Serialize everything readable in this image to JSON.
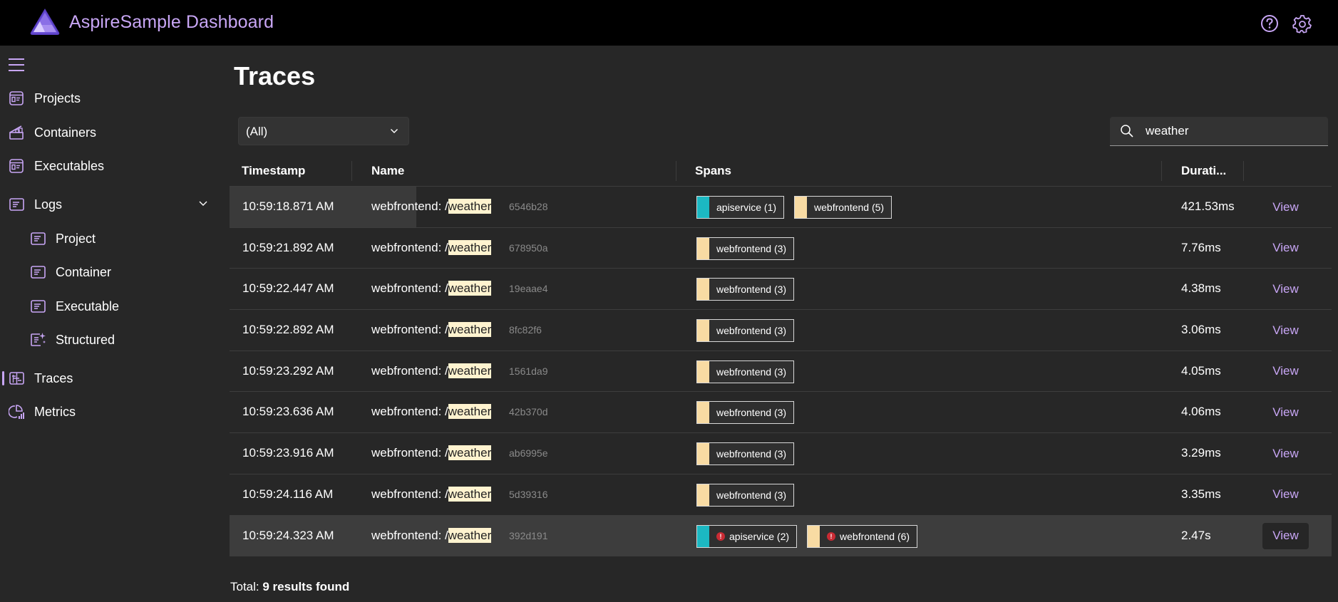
{
  "header": {
    "app_title": "AspireSample Dashboard",
    "help_icon": "help-circle-icon",
    "settings_icon": "gear-icon"
  },
  "sidebar": {
    "menu_icon": "hamburger-icon",
    "items": [
      {
        "label": "Projects",
        "icon": "projects-icon"
      },
      {
        "label": "Containers",
        "icon": "containers-icon"
      },
      {
        "label": "Executables",
        "icon": "executables-icon"
      },
      {
        "label": "Logs",
        "icon": "logs-icon",
        "expanded": true,
        "children": [
          {
            "label": "Project",
            "icon": "log-icon"
          },
          {
            "label": "Container",
            "icon": "log-icon"
          },
          {
            "label": "Executable",
            "icon": "log-icon"
          },
          {
            "label": "Structured",
            "icon": "structured-log-icon"
          }
        ]
      },
      {
        "label": "Traces",
        "icon": "traces-icon",
        "active": true
      },
      {
        "label": "Metrics",
        "icon": "metrics-icon"
      }
    ]
  },
  "main": {
    "title": "Traces",
    "filter": {
      "selected": "(All)"
    },
    "search": {
      "value": "weather",
      "placeholder": ""
    },
    "columns": [
      "Timestamp",
      "Name",
      "Spans",
      "Durati..."
    ],
    "highlight_term": "weather",
    "service_colors": {
      "apiservice": "#1cb8c2",
      "webfrontend": "#f8dba3"
    },
    "rows": [
      {
        "timestamp": "10:59:18.871 AM",
        "name_prefix": "webfrontend: /",
        "name_match": "weather",
        "trace_id": "6546b28",
        "spans": [
          {
            "service": "apiservice",
            "label": "apiservice (1)",
            "error": false
          },
          {
            "service": "webfrontend",
            "label": "webfrontend (5)",
            "error": false
          }
        ],
        "duration": "421.53ms",
        "action": "View"
      },
      {
        "timestamp": "10:59:21.892 AM",
        "name_prefix": "webfrontend: /",
        "name_match": "weather",
        "trace_id": "678950a",
        "spans": [
          {
            "service": "webfrontend",
            "label": "webfrontend (3)",
            "error": false
          }
        ],
        "duration": "7.76ms",
        "action": "View"
      },
      {
        "timestamp": "10:59:22.447 AM",
        "name_prefix": "webfrontend: /",
        "name_match": "weather",
        "trace_id": "19eaae4",
        "spans": [
          {
            "service": "webfrontend",
            "label": "webfrontend (3)",
            "error": false
          }
        ],
        "duration": "4.38ms",
        "action": "View"
      },
      {
        "timestamp": "10:59:22.892 AM",
        "name_prefix": "webfrontend: /",
        "name_match": "weather",
        "trace_id": "8fc82f6",
        "spans": [
          {
            "service": "webfrontend",
            "label": "webfrontend (3)",
            "error": false
          }
        ],
        "duration": "3.06ms",
        "action": "View"
      },
      {
        "timestamp": "10:59:23.292 AM",
        "name_prefix": "webfrontend: /",
        "name_match": "weather",
        "trace_id": "1561da9",
        "spans": [
          {
            "service": "webfrontend",
            "label": "webfrontend (3)",
            "error": false
          }
        ],
        "duration": "4.05ms",
        "action": "View"
      },
      {
        "timestamp": "10:59:23.636 AM",
        "name_prefix": "webfrontend: /",
        "name_match": "weather",
        "trace_id": "42b370d",
        "spans": [
          {
            "service": "webfrontend",
            "label": "webfrontend (3)",
            "error": false
          }
        ],
        "duration": "4.06ms",
        "action": "View"
      },
      {
        "timestamp": "10:59:23.916 AM",
        "name_prefix": "webfrontend: /",
        "name_match": "weather",
        "trace_id": "ab6995e",
        "spans": [
          {
            "service": "webfrontend",
            "label": "webfrontend (3)",
            "error": false
          }
        ],
        "duration": "3.29ms",
        "action": "View"
      },
      {
        "timestamp": "10:59:24.116 AM",
        "name_prefix": "webfrontend: /",
        "name_match": "weather",
        "trace_id": "5d39316",
        "spans": [
          {
            "service": "webfrontend",
            "label": "webfrontend (3)",
            "error": false
          }
        ],
        "duration": "3.35ms",
        "action": "View"
      },
      {
        "timestamp": "10:59:24.323 AM",
        "name_prefix": "webfrontend: /",
        "name_match": "weather",
        "trace_id": "392d191",
        "spans": [
          {
            "service": "apiservice",
            "label": "apiservice (2)",
            "error": true
          },
          {
            "service": "webfrontend",
            "label": "webfrontend (6)",
            "error": true
          }
        ],
        "duration": "2.47s",
        "action": "View",
        "selected": true
      }
    ],
    "total_label": "Total:",
    "total_value": "9 results found"
  }
}
